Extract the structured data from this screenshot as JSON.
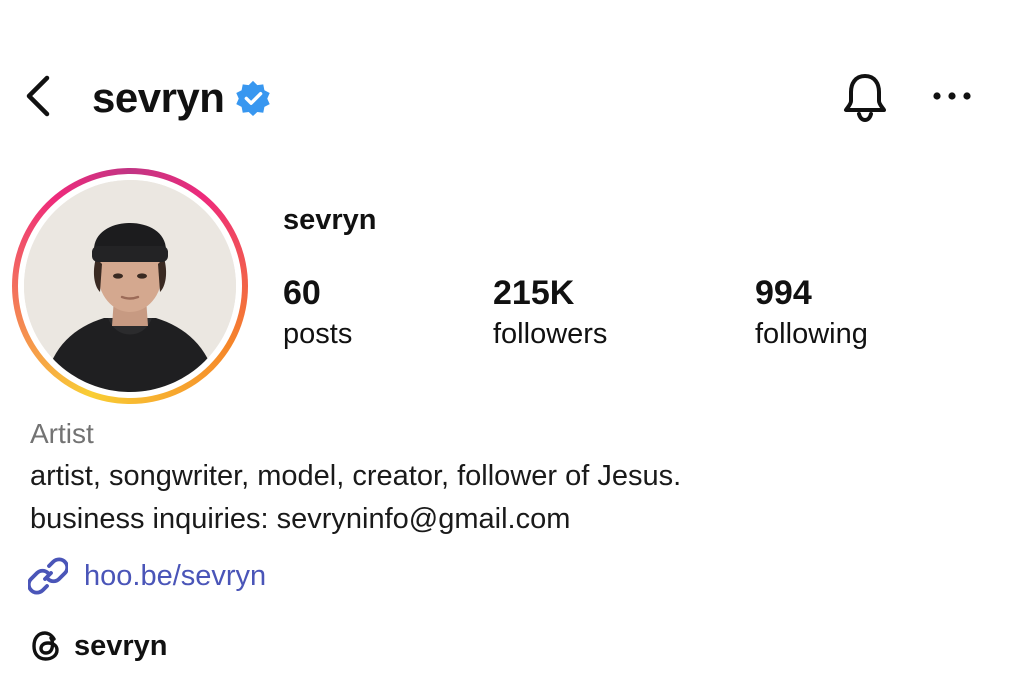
{
  "header": {
    "title": "sevryn",
    "icons": {
      "back": "chevron-left-icon",
      "verified": "verified-badge-icon",
      "notifications": "bell-icon",
      "more": "more-horizontal-icon"
    }
  },
  "profile": {
    "display_name": "sevryn",
    "avatar": "profile-photo",
    "story_ring_colors": [
      "#f9ce34",
      "#ee2a7b",
      "#c13584",
      "#f58529"
    ],
    "stats": [
      {
        "value": "60",
        "label": "posts"
      },
      {
        "value": "215K",
        "label": "followers"
      },
      {
        "value": "994",
        "label": "following"
      }
    ]
  },
  "bio": {
    "category": "Artist",
    "lines": [
      "artist, songwriter, model, creator, follower of Jesus.",
      "business inquiries: sevryninfo@gmail.com"
    ],
    "link": "hoo.be/sevryn",
    "link_color": "#4a55b8"
  },
  "threads": {
    "handle": "sevryn",
    "icon": "threads-icon"
  },
  "colors": {
    "verified": "#3897f0",
    "muted": "#737373"
  }
}
